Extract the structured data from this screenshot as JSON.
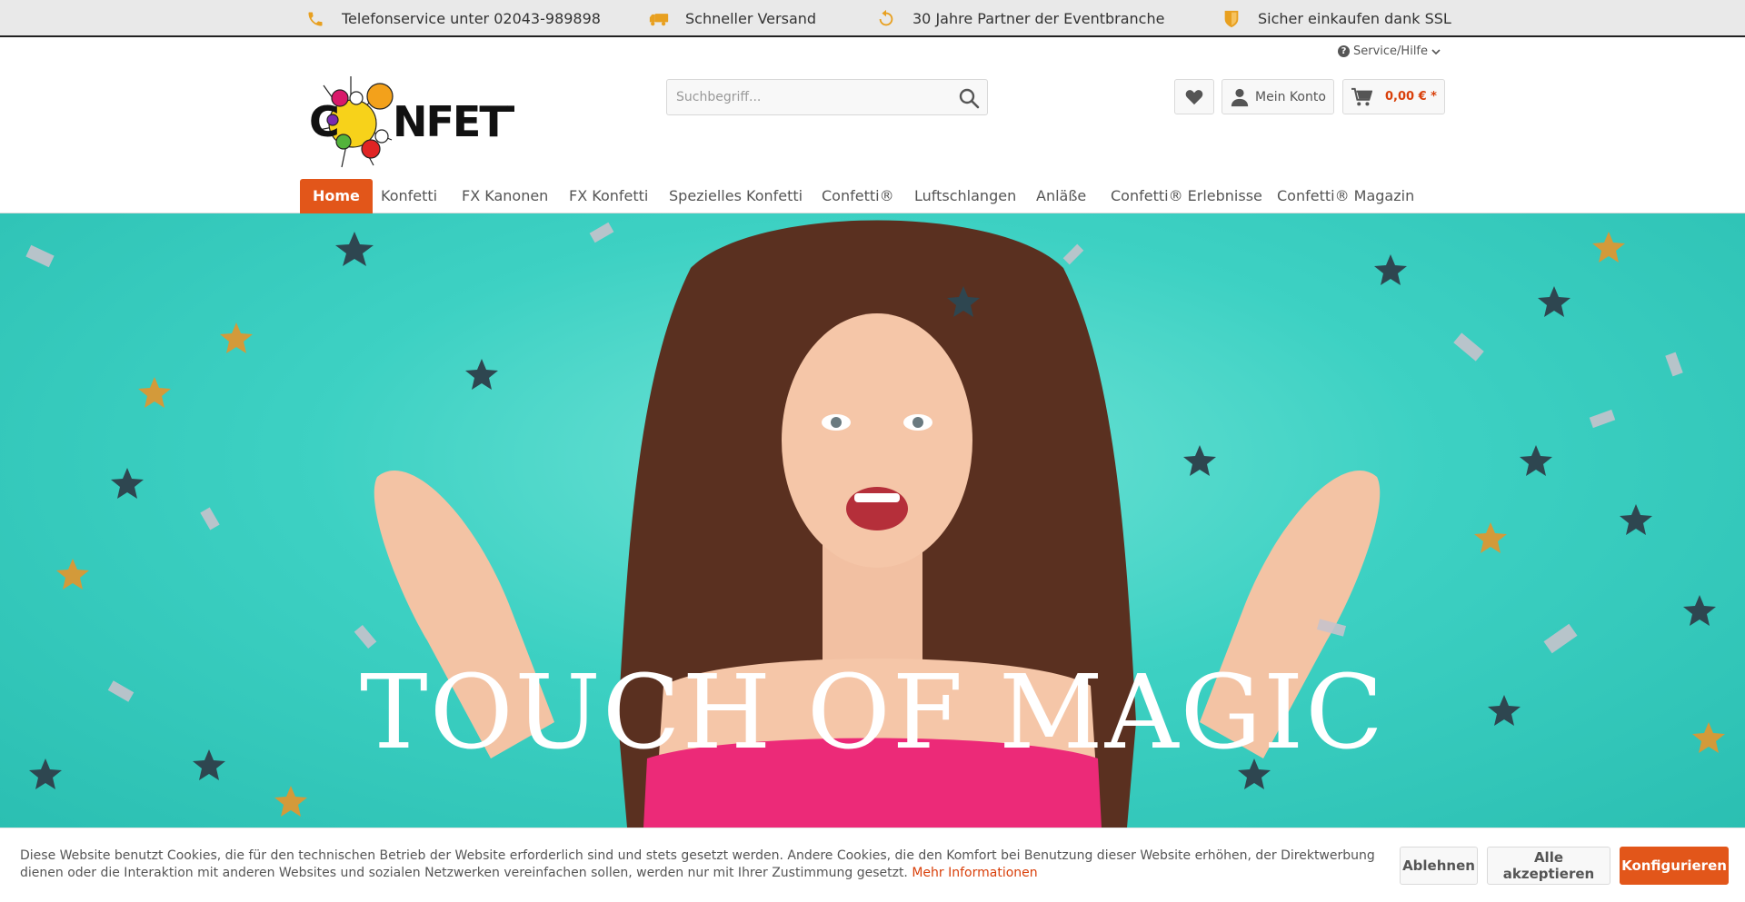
{
  "topbar": {
    "items": [
      {
        "icon": "phone-icon",
        "label": "Telefonservice unter 02043-989898"
      },
      {
        "icon": "truck-icon",
        "label": "Schneller Versand"
      },
      {
        "icon": "refresh-icon",
        "label": "30 Jahre Partner der Eventbranche"
      },
      {
        "icon": "shield-icon",
        "label": "Sicher einkaufen dank SSL"
      }
    ]
  },
  "header": {
    "service_label": "Service/Hilfe",
    "logo_text": "CONFETTI",
    "search_placeholder": "Suchbegriff...",
    "account_label": "Mein Konto",
    "cart_amount": "0,00 € *"
  },
  "nav": {
    "items": [
      {
        "label": "Home",
        "active": true
      },
      {
        "label": "Konfetti"
      },
      {
        "label": "FX Kanonen"
      },
      {
        "label": "FX Konfetti"
      },
      {
        "label": "Spezielles Konfetti"
      },
      {
        "label": "Confetti®"
      },
      {
        "label": "Luftschlangen"
      },
      {
        "label": "Anläße"
      },
      {
        "label": "Confetti® Erlebnisse"
      },
      {
        "label": "Confetti® Magazin"
      }
    ]
  },
  "hero": {
    "title": "TOUCH OF MAGIC"
  },
  "cookie": {
    "text": "Diese Website benutzt Cookies, die für den technischen Betrieb der Website erforderlich sind und stets gesetzt werden. Andere Cookies, die den Komfort bei Benutzung dieser Website erhöhen, der Direktwerbung dienen oder die Interaktion mit anderen Websites und sozialen Netzwerken vereinfachen sollen, werden nur mit Ihrer Zustimmung gesetzt.",
    "more_label": "Mehr Informationen",
    "decline_label": "Ablehnen",
    "accept_label": "Alle akzeptieren",
    "configure_label": "Konfigurieren"
  },
  "colors": {
    "accent": "#e2561a",
    "icon_gold": "#e8a020",
    "hero_bg": "#3dd1c3"
  }
}
